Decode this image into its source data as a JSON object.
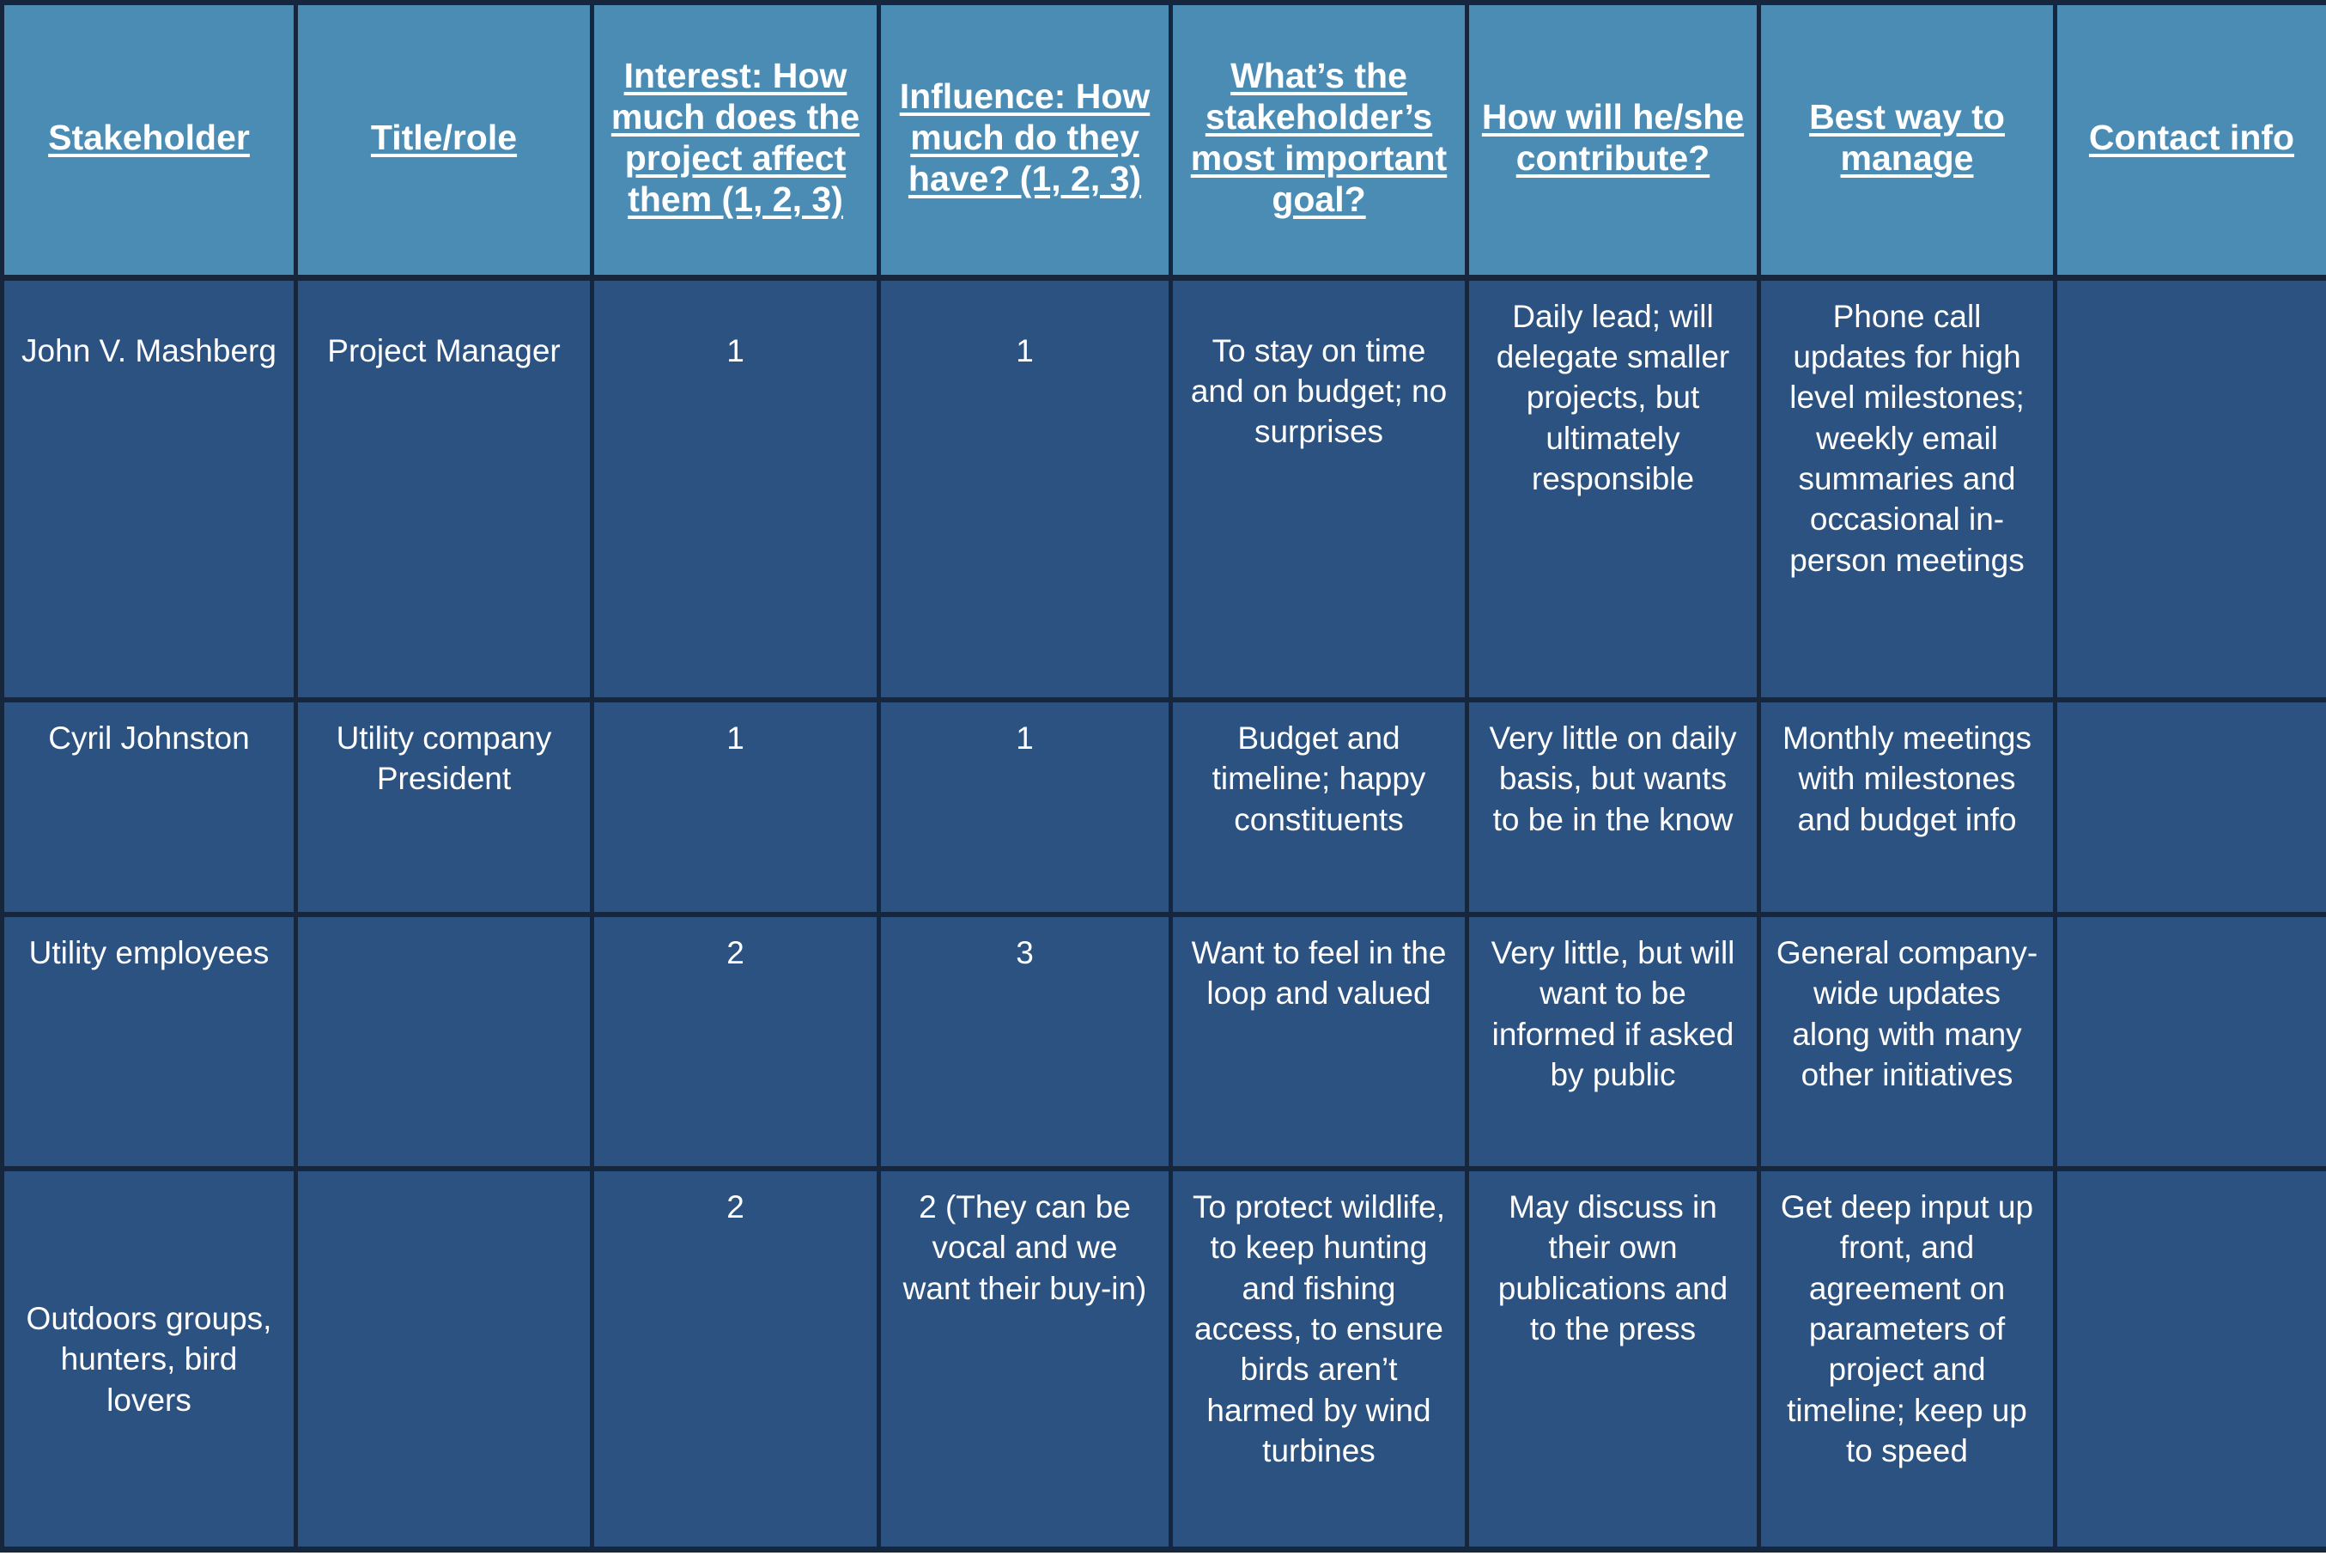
{
  "table": {
    "name": "Stakeholder analysis table",
    "colors": {
      "header_background": "#4b8cb5",
      "body_background": "#2b5280",
      "border": "#16263d",
      "text": "#ffffff"
    },
    "columns": [
      {
        "id": "stakeholder",
        "label": "Stakeholder"
      },
      {
        "id": "title_role",
        "label": "Title/role"
      },
      {
        "id": "interest",
        "label": "Interest: How much does the project affect them (1, 2, 3)"
      },
      {
        "id": "influence",
        "label": "Influence: How much do they have? (1, 2, 3)"
      },
      {
        "id": "goal",
        "label": "What’s the stakeholder’s most important goal?"
      },
      {
        "id": "contribute",
        "label": "How will he/she contribute?"
      },
      {
        "id": "manage",
        "label": "Best way to manage"
      },
      {
        "id": "contact",
        "label": "Contact info"
      }
    ],
    "rows": [
      {
        "stakeholder": "John V. Mashberg",
        "title_role": "Project Manager",
        "interest": "1",
        "influence": "1",
        "goal": "To stay on time and on budget; no surprises",
        "contribute": "Daily lead; will delegate smaller projects, but ultimately responsible",
        "manage": "Phone call updates for high level milestones; weekly email summaries and occasional in-person meetings",
        "contact": ""
      },
      {
        "stakeholder": "Cyril Johnston",
        "title_role": "Utility company President",
        "interest": "1",
        "influence": "1",
        "goal": "Budget and timeline; happy constituents",
        "contribute": "Very little on daily basis, but wants to be in the know",
        "manage": "Monthly meetings with milestones and budget info",
        "contact": ""
      },
      {
        "stakeholder": "Utility employees",
        "title_role": "",
        "interest": "2",
        "influence": "3",
        "goal": "Want to feel in the loop and valued",
        "contribute": "Very little, but will want to be informed if asked by public",
        "manage": "General company-wide updates along with many other initiatives",
        "contact": ""
      },
      {
        "stakeholder": "Outdoors groups, hunters, bird lovers",
        "title_role": "",
        "interest": "2",
        "influence": "2 (They can be vocal and we want their buy-in)",
        "goal": "To protect wildlife, to keep hunting and fishing access, to ensure birds aren’t harmed by wind turbines",
        "contribute": "May discuss in their own publications and to the press",
        "manage": "Get deep input up front, and agreement on parameters of project and timeline; keep up to speed",
        "contact": ""
      }
    ]
  }
}
